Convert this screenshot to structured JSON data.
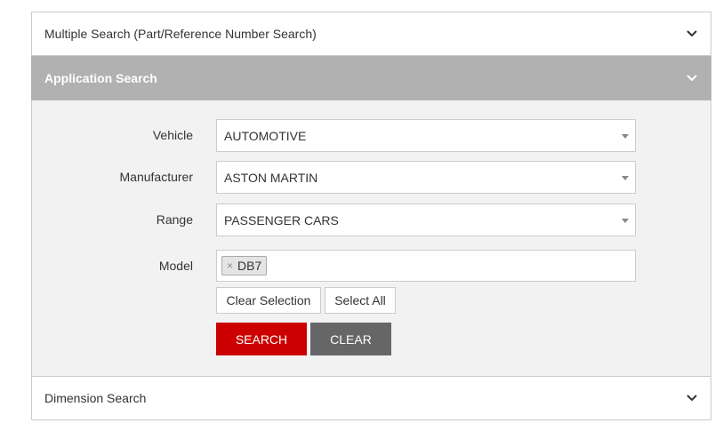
{
  "accordion": {
    "multiple_search": {
      "title": "Multiple Search (Part/Reference Number Search)"
    },
    "application_search": {
      "title": "Application Search",
      "fields": {
        "vehicle": {
          "label": "Vehicle",
          "value": "AUTOMOTIVE"
        },
        "manufacturer": {
          "label": "Manufacturer",
          "value": "ASTON MARTIN"
        },
        "range": {
          "label": "Range",
          "value": "PASSENGER CARS"
        },
        "model": {
          "label": "Model",
          "selected_tags": [
            {
              "label": "DB7",
              "remove_glyph": "×"
            }
          ]
        }
      },
      "buttons": {
        "clear_selection": "Clear Selection",
        "select_all": "Select All",
        "search": "SEARCH",
        "clear": "CLEAR"
      }
    },
    "dimension_search": {
      "title": "Dimension Search"
    }
  },
  "colors": {
    "active_header_bg": "#b1b1b1",
    "body_bg": "#f2f2f2",
    "search_button": "#cc0000",
    "clear_button": "#666666"
  },
  "icons": {
    "collapsed": "chevron-down-icon",
    "expanded": "chevron-down-icon"
  }
}
